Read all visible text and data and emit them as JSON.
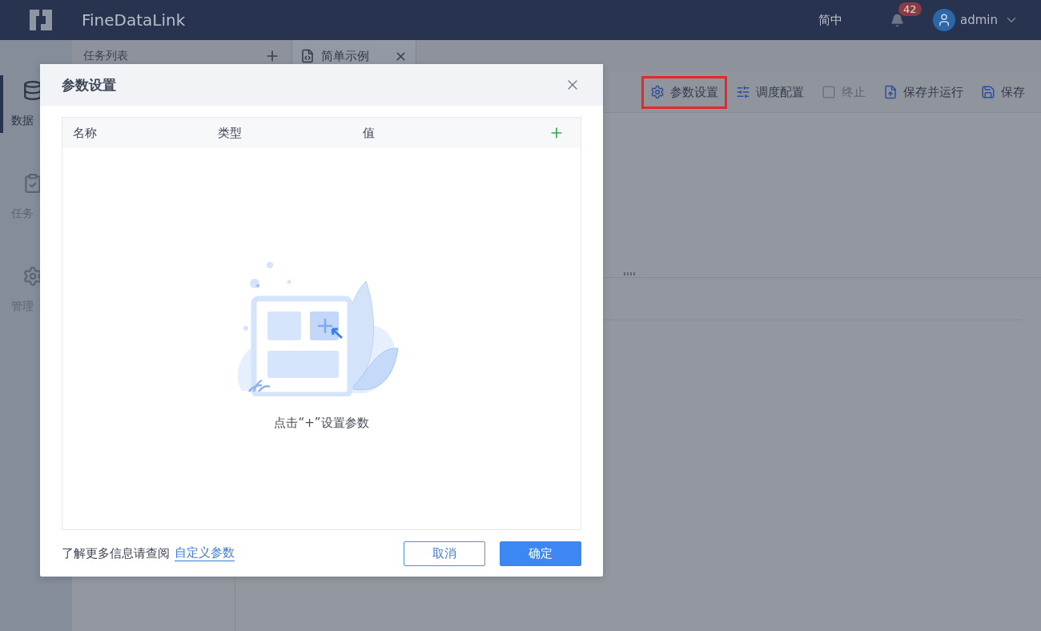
{
  "header": {
    "logo": "FineDataLink",
    "language": "简中",
    "notifications": "42",
    "user": "admin"
  },
  "sidebar": {
    "items": [
      {
        "label": "数据",
        "selected": true
      },
      {
        "label": "任务",
        "selected": false
      },
      {
        "label": "管理",
        "selected": false
      }
    ]
  },
  "task_list": {
    "title": "任务列表"
  },
  "tabs": [
    {
      "label": "简单示例",
      "selected": true
    }
  ],
  "toolbar": [
    {
      "label": "参数设置",
      "disabled": false,
      "highlighted": true
    },
    {
      "label": "调度配置",
      "disabled": false,
      "highlighted": false
    },
    {
      "label": "终止",
      "disabled": true,
      "highlighted": false
    },
    {
      "label": "保存并运行",
      "disabled": false,
      "highlighted": false
    },
    {
      "label": "保存",
      "disabled": false,
      "highlighted": false
    }
  ],
  "dialog": {
    "title": "参数设置",
    "columns": [
      "名称",
      "类型",
      "值"
    ],
    "empty_text": "点击“+”设置参数",
    "help_text": "了解更多信息请查阅",
    "help_link": "自定义参数",
    "buttons": [
      {
        "label": "取消",
        "kind": "secondary"
      },
      {
        "label": "确定",
        "kind": "primary"
      }
    ]
  }
}
